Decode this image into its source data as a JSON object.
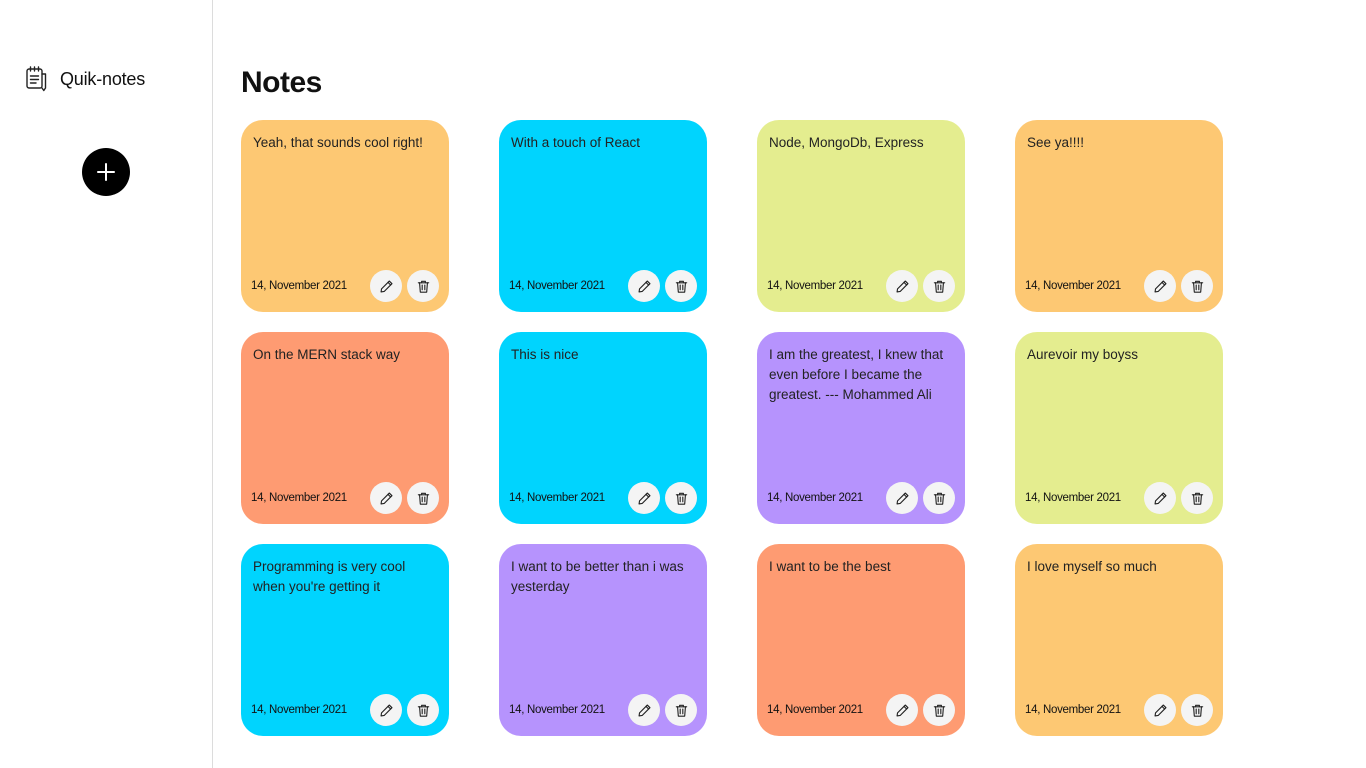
{
  "app": {
    "brand_name": "Quik-notes",
    "brand_icon": "notebook-icon",
    "add_icon": "plus-icon"
  },
  "main": {
    "title": "Notes"
  },
  "colors": {
    "orange": "#fdc873",
    "cyan": "#00d4fe",
    "lime": "#e4ed8f",
    "salmon": "#fe9b72",
    "purple": "#b693fd"
  },
  "notes": [
    {
      "text": "Yeah, that sounds cool right!",
      "date": "14, November 2021",
      "color": "#fdc873"
    },
    {
      "text": "With a touch of React",
      "date": "14, November 2021",
      "color": "#00d4fe"
    },
    {
      "text": "Node, MongoDb, Express",
      "date": "14, November 2021",
      "color": "#e4ed8f"
    },
    {
      "text": "See ya!!!!",
      "date": "14, November 2021",
      "color": "#fdc873"
    },
    {
      "text": "On the MERN stack way",
      "date": "14, November 2021",
      "color": "#fe9b72"
    },
    {
      "text": "This is nice",
      "date": "14, November 2021",
      "color": "#00d4fe"
    },
    {
      "text": "I am the greatest, I knew that even before I became the greatest. --- Mohammed Ali",
      "date": "14, November 2021",
      "color": "#b693fd"
    },
    {
      "text": "Aurevoir my boyss",
      "date": "14, November 2021",
      "color": "#e4ed8f"
    },
    {
      "text": "Programming is very cool when you're getting it",
      "date": "14, November 2021",
      "color": "#00d4fe"
    },
    {
      "text": "I want to be better than i was yesterday",
      "date": "14, November 2021",
      "color": "#b693fd"
    },
    {
      "text": "I want to be the best",
      "date": "14, November 2021",
      "color": "#fe9b72"
    },
    {
      "text": "I love myself so much",
      "date": "14, November 2021",
      "color": "#fdc873"
    }
  ],
  "note_actions": {
    "edit_icon": "pencil-icon",
    "delete_icon": "trash-icon"
  }
}
